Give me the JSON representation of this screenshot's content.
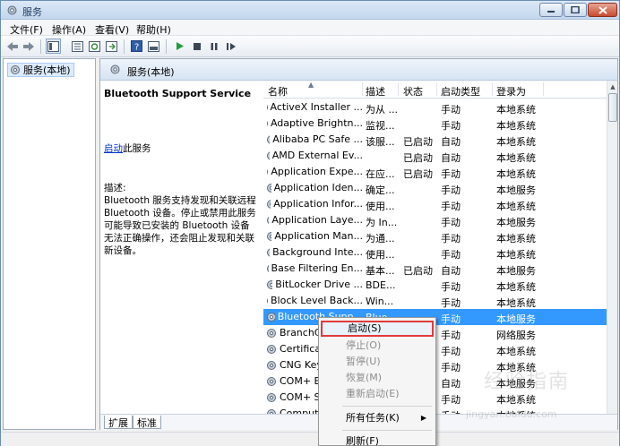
{
  "window": {
    "title": "服务"
  },
  "menubar": [
    {
      "label": "文件(F)"
    },
    {
      "label": "操作(A)"
    },
    {
      "label": "查看(V)"
    },
    {
      "label": "帮助(H)"
    }
  ],
  "tree": {
    "root": "服务(本地)"
  },
  "pane": {
    "header": "服务(本地)"
  },
  "detail": {
    "service_name": "Bluetooth Support Service",
    "start_link": "启动",
    "start_suffix": "此服务",
    "desc_label": "描述:",
    "desc_text": "Bluetooth 服务支持发现和关联远程 Bluetooth 设备。停止或禁用此服务可能导致已安装的 Bluetooth 设备无法正确操作，还会阻止发现和关联新设备。"
  },
  "columns": {
    "name": "名称",
    "desc": "描述",
    "status": "状态",
    "startup": "启动类型",
    "logon": "登录为"
  },
  "rows": [
    {
      "name": "ActiveX Installer ...",
      "desc": "为从 ...",
      "status": "",
      "startup": "手动",
      "logon": "本地系统"
    },
    {
      "name": "Adaptive Brightn...",
      "desc": "监视...",
      "status": "",
      "startup": "手动",
      "logon": "本地系统"
    },
    {
      "name": "Alibaba PC Safe ...",
      "desc": "该服...",
      "status": "已启动",
      "startup": "自动",
      "logon": "本地系统"
    },
    {
      "name": "AMD External Ev...",
      "desc": "",
      "status": "已启动",
      "startup": "自动",
      "logon": "本地系统"
    },
    {
      "name": "Application Expe...",
      "desc": "在应...",
      "status": "已启动",
      "startup": "手动",
      "logon": "本地系统"
    },
    {
      "name": "Application Iden...",
      "desc": "确定...",
      "status": "",
      "startup": "手动",
      "logon": "本地服务"
    },
    {
      "name": "Application Infor...",
      "desc": "使用...",
      "status": "",
      "startup": "手动",
      "logon": "本地系统"
    },
    {
      "name": "Application Laye...",
      "desc": "为 In...",
      "status": "",
      "startup": "手动",
      "logon": "本地服务"
    },
    {
      "name": "Application Man...",
      "desc": "为通...",
      "status": "",
      "startup": "手动",
      "logon": "本地系统"
    },
    {
      "name": "Background Inte...",
      "desc": "使用...",
      "status": "",
      "startup": "手动",
      "logon": "本地系统"
    },
    {
      "name": "Base Filtering En...",
      "desc": "基本...",
      "status": "已启动",
      "startup": "自动",
      "logon": "本地服务"
    },
    {
      "name": "BitLocker Drive ...",
      "desc": "BDE...",
      "status": "",
      "startup": "手动",
      "logon": "本地系统"
    },
    {
      "name": "Block Level Back...",
      "desc": "Win...",
      "status": "",
      "startup": "手动",
      "logon": "本地系统"
    },
    {
      "name": "Bluetooth Supp...",
      "desc": "Blue...",
      "status": "",
      "startup": "手动",
      "logon": "本地服务"
    },
    {
      "name": "BranchCa...",
      "desc": "",
      "status": "",
      "startup": "手动",
      "logon": "网络服务"
    },
    {
      "name": "Certificat...",
      "desc": "",
      "status": "",
      "startup": "手动",
      "logon": "本地系统"
    },
    {
      "name": "CNG Key ...",
      "desc": "",
      "status": "",
      "startup": "手动",
      "logon": "本地系统"
    },
    {
      "name": "COM+ Ev...",
      "desc": "",
      "status": "",
      "startup": "自动",
      "logon": "本地服务"
    },
    {
      "name": "COM+ Sy...",
      "desc": "",
      "status": "",
      "startup": "手动",
      "logon": "本地系统"
    },
    {
      "name": "Compute...",
      "desc": "",
      "status": "",
      "startup": "手动",
      "logon": "本地系统"
    }
  ],
  "tabs": {
    "extended": "扩展",
    "standard": "标准"
  },
  "context_menu": {
    "start": "启动(S)",
    "stop": "停止(O)",
    "pause": "暂停(U)",
    "resume": "恢复(M)",
    "restart": "重新启动(E)",
    "all_tasks": "所有任务(K)",
    "refresh": "刷新(F)"
  },
  "watermark": {
    "main": "经验指南",
    "sub": "jingyan.baidu.com"
  },
  "colors": {
    "selection": "#3399ff",
    "highlight_border": "#e23a3a",
    "link": "#0033cc"
  }
}
